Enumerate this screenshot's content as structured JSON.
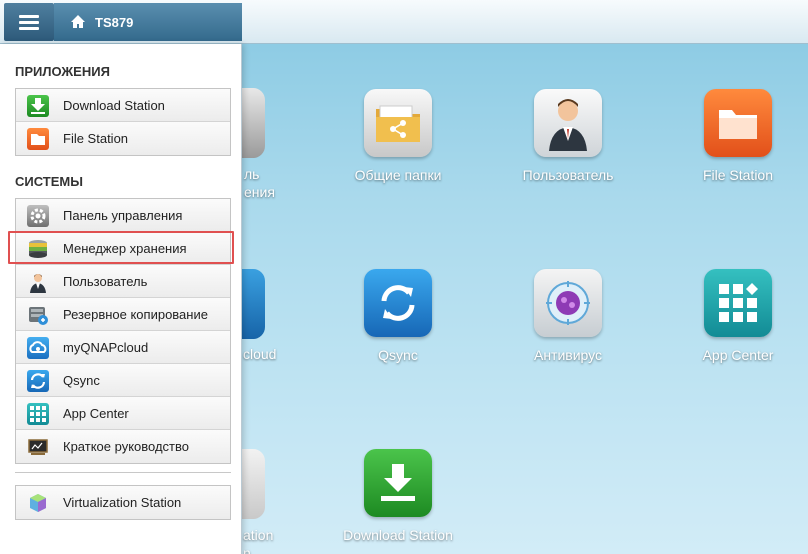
{
  "header": {
    "device_name": "TS879"
  },
  "menu": {
    "apps_title": "ПРИЛОЖЕНИЯ",
    "apps": [
      {
        "label": "Download Station",
        "icon": "download-icon"
      },
      {
        "label": "File Station",
        "icon": "folder-icon"
      }
    ],
    "systems_title": "СИСТЕМЫ",
    "systems": [
      {
        "label": "Панель управления",
        "icon": "gear-icon"
      },
      {
        "label": "Менеджер хранения",
        "icon": "storage-icon",
        "highlighted": true
      },
      {
        "label": "Пользователь",
        "icon": "user-icon"
      },
      {
        "label": "Резервное копирование",
        "icon": "backup-icon"
      },
      {
        "label": "myQNAPcloud",
        "icon": "cloud-icon"
      },
      {
        "label": "Qsync",
        "icon": "sync-icon"
      },
      {
        "label": "App Center",
        "icon": "app-grid-icon"
      },
      {
        "label": "Краткое руководство",
        "icon": "guide-icon"
      }
    ],
    "extra": [
      {
        "label": "Virtualization Station",
        "icon": "cube-icon"
      }
    ]
  },
  "desktop": {
    "icons": [
      {
        "label": "Общие папки",
        "icon": "shared-folder-icon"
      },
      {
        "label": "Пользователь",
        "icon": "user-icon"
      },
      {
        "label": "File Station",
        "icon": "folder-icon"
      },
      {
        "label": "Qsync",
        "icon": "sync-icon"
      },
      {
        "label": "Антивирус",
        "icon": "antivirus-icon"
      },
      {
        "label": "App Center",
        "icon": "app-grid-icon"
      },
      {
        "label": "Download Station",
        "icon": "download-icon"
      }
    ],
    "partial_labels": {
      "row1_line1": "ль",
      "row1_line2": "ения",
      "row2": "cloud",
      "row3_line1": "ation",
      "row3_line2": "n"
    }
  },
  "colors": {
    "highlight_border": "#e05050",
    "accent": "#2d5a7a"
  }
}
